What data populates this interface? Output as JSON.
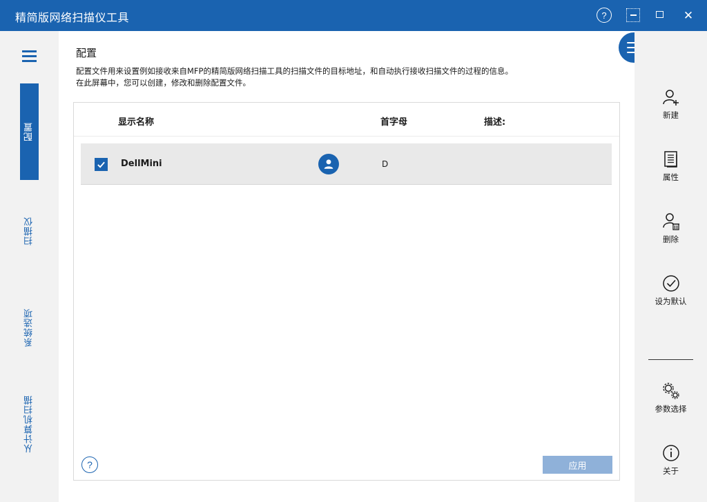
{
  "window": {
    "title": "精简版网络扫描仪工具",
    "help_label": "?",
    "close_label": "✕"
  },
  "left_nav": {
    "items": [
      {
        "label": "配置",
        "active": true
      },
      {
        "label": "扫描仪",
        "active": false
      },
      {
        "label": "系统选项",
        "active": false
      },
      {
        "label": "从计算机扫描",
        "active": false
      }
    ]
  },
  "main": {
    "title": "配置",
    "description_line1": "配置文件用来设置例如接收来自MFP的精简版网络扫描工具的扫描文件的目标地址，和自动执行接收扫描文件的过程的信息。",
    "description_line2": "在此屏幕中，您可以创建，修改和删除配置文件。",
    "table": {
      "headers": [
        "显示名称",
        "首字母",
        "描述:"
      ],
      "rows": [
        {
          "checked": true,
          "name": "DellMini",
          "initial": "D",
          "description": ""
        }
      ]
    },
    "help_label": "?",
    "apply_label": "应用"
  },
  "right_toolbar": {
    "items": [
      {
        "label": "新建",
        "icon": "add-user-icon"
      },
      {
        "label": "属性",
        "icon": "properties-icon"
      },
      {
        "label": "删除",
        "icon": "delete-user-icon"
      },
      {
        "label": "设为默认",
        "icon": "check-circle-icon"
      },
      {
        "label": "参数选择",
        "icon": "gears-icon"
      },
      {
        "label": "关于",
        "icon": "info-icon"
      }
    ]
  },
  "colors": {
    "primary": "#1a63b0",
    "sidebar_bg": "#f2f2f2",
    "row_bg": "#e9e9e9",
    "apply_disabled": "#8fb1d9"
  }
}
